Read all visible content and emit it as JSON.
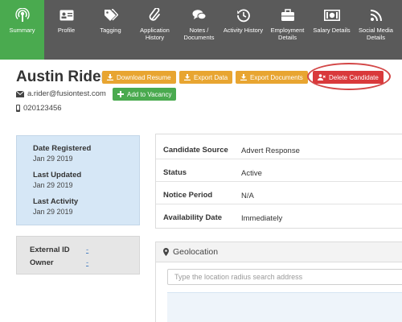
{
  "nav": {
    "items": [
      {
        "label": "Summary",
        "icon": "podcast-icon",
        "active": true
      },
      {
        "label": "Profile",
        "icon": "id-card-icon"
      },
      {
        "label": "Tagging",
        "icon": "tags-icon"
      },
      {
        "label": "Application History",
        "icon": "paperclip-icon"
      },
      {
        "label": "Notes / Documents",
        "icon": "comments-icon"
      },
      {
        "label": "Activity History",
        "icon": "history-icon"
      },
      {
        "label": "Employment Details",
        "icon": "briefcase-icon"
      },
      {
        "label": "Salary Details",
        "icon": "money-icon"
      },
      {
        "label": "Social Media Details",
        "icon": "rss-icon"
      }
    ],
    "active_color": "#4aaa4f",
    "bar_color": "#5a5a5a"
  },
  "candidate": {
    "name": "Austin Rider",
    "email": "a.rider@fusiontest.com",
    "phone": "020123456"
  },
  "actions": {
    "download_resume": "Download Resume",
    "export_data": "Export Data",
    "export_documents": "Export Documents",
    "delete_candidate": "Delete Candidate",
    "add_to_vacancy": "Add to Vacancy"
  },
  "dates": {
    "registered_label": "Date Registered",
    "registered_value": "Jan 29 2019",
    "updated_label": "Last Updated",
    "updated_value": "Jan 29 2019",
    "activity_label": "Last Activity",
    "activity_value": "Jan 29 2019"
  },
  "external": {
    "id_label": "External ID",
    "id_value": "-",
    "owner_label": "Owner",
    "owner_value": "-"
  },
  "details": {
    "rows": [
      {
        "label": "Candidate Source",
        "value": "Advert Response"
      },
      {
        "label": "Status",
        "value": "Active"
      },
      {
        "label": "Notice Period",
        "value": "N/A"
      },
      {
        "label": "Availability Date",
        "value": "Immediately"
      }
    ]
  },
  "geolocation": {
    "title": "Geolocation",
    "search_placeholder": "Type the location radius search address"
  },
  "colors": {
    "orange": "#e8a531",
    "red": "#d9393b",
    "green": "#4aaa4f",
    "info_bg": "#d6e7f6"
  }
}
